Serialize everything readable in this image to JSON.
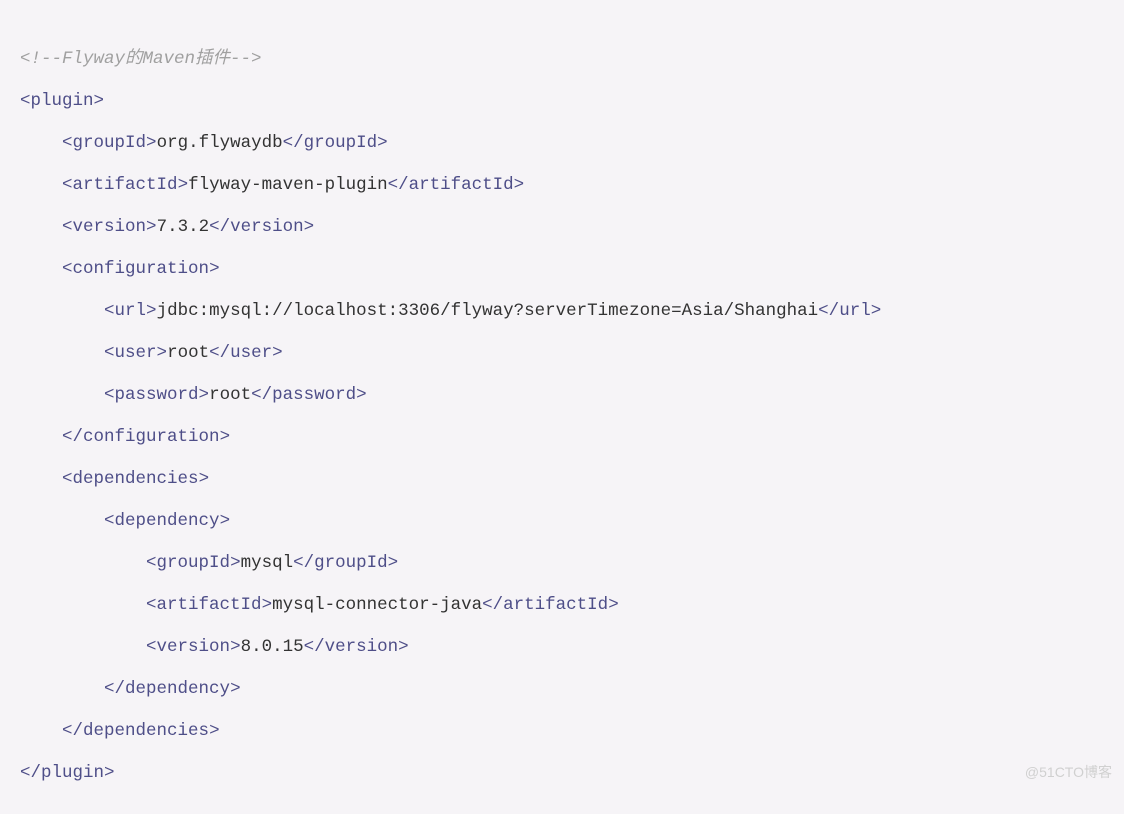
{
  "comment": "<!--Flyway的Maven插件-->",
  "watermark": "@51CTO博客",
  "code": {
    "plugin": {
      "groupId": "org.flywaydb",
      "artifactId": "flyway-maven-plugin",
      "version": "7.3.2",
      "configuration": {
        "url": "jdbc:mysql://localhost:3306/flyway?serverTimezone=Asia/Shanghai",
        "user": "root",
        "password": "root"
      },
      "dependencies": [
        {
          "groupId": "mysql",
          "artifactId": "mysql-connector-java",
          "version": "8.0.15"
        }
      ]
    }
  },
  "tags": {
    "plugin": "plugin",
    "groupId": "groupId",
    "artifactId": "artifactId",
    "version": "version",
    "configuration": "configuration",
    "url": "url",
    "user": "user",
    "password": "password",
    "dependencies": "dependencies",
    "dependency": "dependency"
  }
}
